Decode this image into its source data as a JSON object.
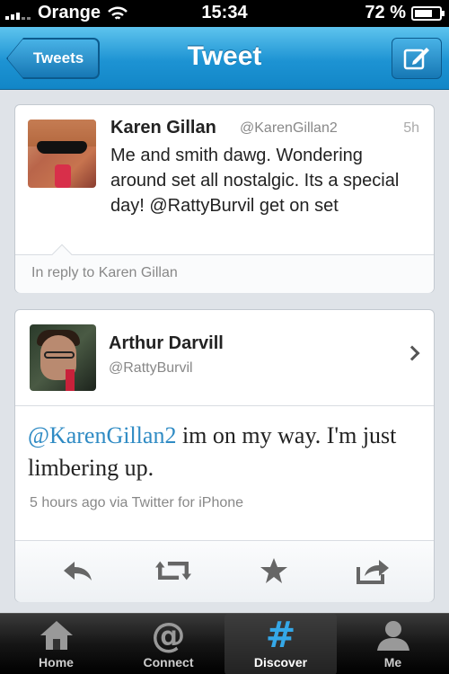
{
  "status_bar": {
    "carrier": "Orange",
    "time": "15:34",
    "battery_percent": "72 %",
    "battery_level": 0.72
  },
  "nav": {
    "back_label": "Tweets",
    "title": "Tweet",
    "compose_icon": "compose-icon"
  },
  "reply_tweet": {
    "name": "Karen Gillan",
    "handle": "@KarenGillan2",
    "time": "5h",
    "text": "Me and smith dawg. Wondering around set all nostalgic. Its a special day! @RattyBurvil get on set",
    "reply_context": "In reply to Karen Gillan"
  },
  "main_tweet": {
    "name": "Arthur Darvill",
    "handle": "@RattyBurvil",
    "mention": "@KarenGillan2",
    "text": " im on my way. I'm just limbering up.",
    "meta": "5 hours ago via Twitter for iPhone",
    "actions": [
      "reply-icon",
      "retweet-icon",
      "favorite-icon",
      "share-icon"
    ]
  },
  "tabs": [
    {
      "label": "Home",
      "icon": "home-icon",
      "active": false
    },
    {
      "label": "Connect",
      "icon": "at-icon",
      "active": false
    },
    {
      "label": "Discover",
      "icon": "hash-icon",
      "active": true
    },
    {
      "label": "Me",
      "icon": "person-icon",
      "active": false
    }
  ],
  "colors": {
    "nav_blue": "#1d93d3",
    "mention_blue": "#2f8bc4",
    "discover_blue": "#35a8e8"
  }
}
